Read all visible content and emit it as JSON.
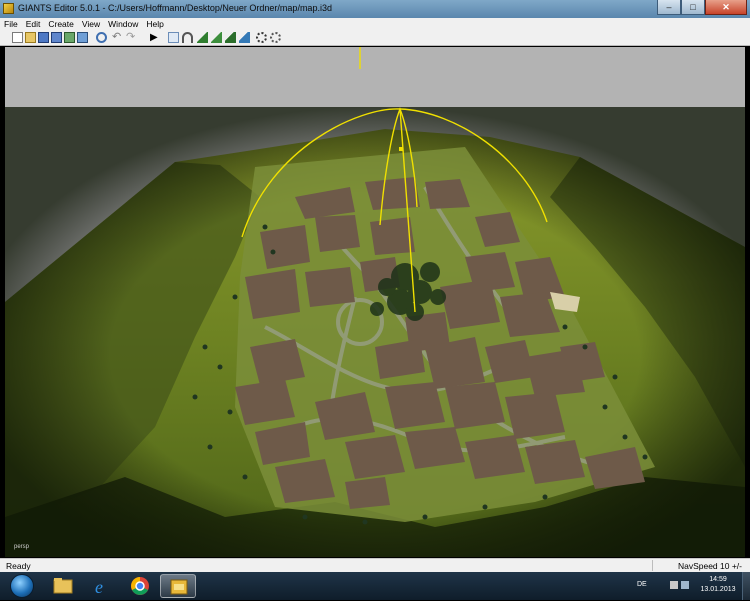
{
  "window": {
    "title": "GIANTS Editor 5.0.1 - C:/Users/Hoffmann/Desktop/Neuer Ordner/map/map.i3d",
    "minimize_glyph": "–",
    "maximize_glyph": "□",
    "close_glyph": "✕"
  },
  "menu": [
    "File",
    "Edit",
    "Create",
    "View",
    "Window",
    "Help"
  ],
  "toolbar": {
    "icons": [
      "new-icon",
      "open-icon",
      "save-icon",
      "save-as-icon",
      "export-icon",
      "import-icon",
      "reload-icon",
      "undo-icon",
      "redo-icon",
      "play-icon",
      "select-icon",
      "magnet-icon",
      "terrain-sculpt-icon",
      "terrain-paint-icon",
      "foliage-paint-icon",
      "placement-icon",
      "snap-icon",
      "settings-icon"
    ]
  },
  "viewport": {
    "camera_label": "persp"
  },
  "status": {
    "left": "Ready",
    "right": "NavSpeed 10 +/-"
  },
  "taskbar": {
    "apps": [
      "windows-explorer",
      "internet-explorer",
      "google-chrome",
      "giants-editor"
    ],
    "language": "DE",
    "time": "14:59",
    "date": "13.01.2013"
  },
  "colors": {
    "titlebar": "#6e97bb",
    "viewport_bg": "#b3b3b3",
    "terrain_grass": "#6d8222",
    "fields": "#6e5a49",
    "gizmo": "#f0e000",
    "taskbar": "#1a2d3f"
  }
}
